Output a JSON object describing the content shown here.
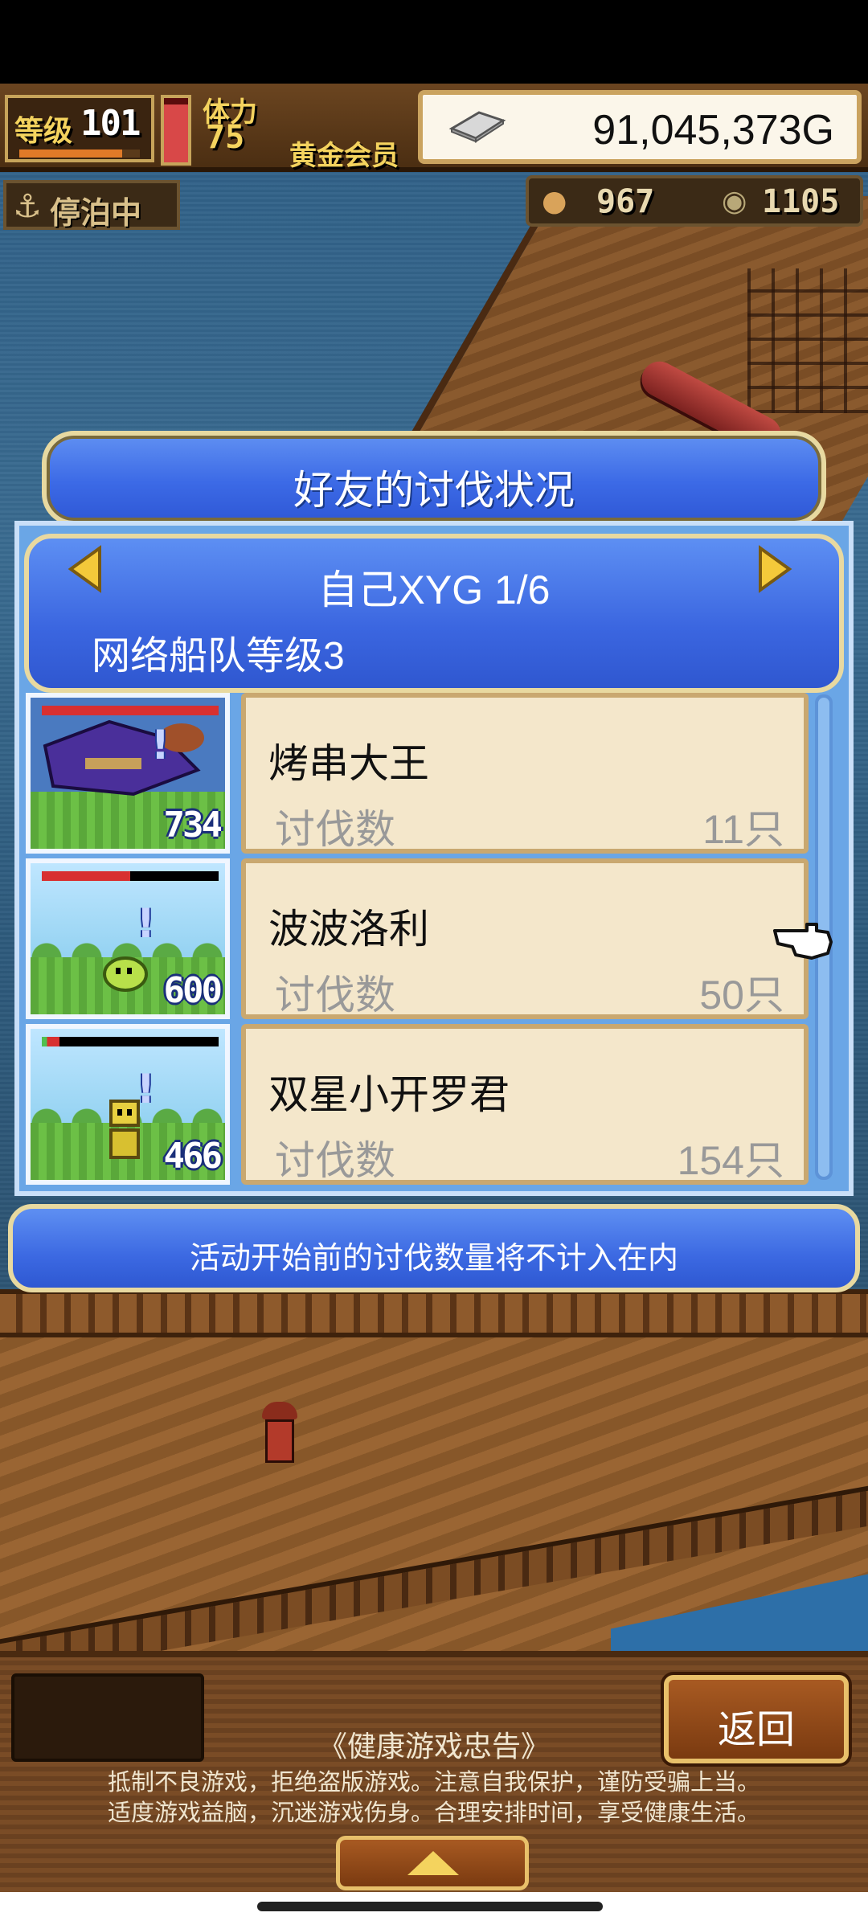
{
  "hud": {
    "level_label": "等级",
    "level": "101",
    "level_progress": 0.85,
    "stamina_label": "体力",
    "stamina": "75",
    "stamina_fill": 0.9,
    "membership": "黄金会员",
    "gold": "91,045,373G",
    "status": "停泊中",
    "resource_1": "967",
    "resource_2": "1105"
  },
  "dialog": {
    "title": "好友的讨伐状况",
    "friend": "自己XYG 1/6",
    "fleet_level": "网络船队等级3",
    "kill_label": "讨伐数",
    "monsters": [
      {
        "name": "烤串大王",
        "power": "734",
        "kills": "11只",
        "hp": 1.0,
        "sprite": "wizard-boss"
      },
      {
        "name": "波波洛利",
        "power": "600",
        "kills": "50只",
        "hp": 0.5,
        "sprite": "green-blob"
      },
      {
        "name": "双星小开罗君",
        "power": "466",
        "kills": "154只",
        "hp": 0.1,
        "sprite": "yellow-robot"
      }
    ],
    "notice": "活动开始前的讨伐数量将不计入在内"
  },
  "bottom": {
    "back_label": "返回",
    "health_title": "《健康游戏忠告》",
    "health_line_1": "抵制不良游戏，拒绝盗版游戏。注意自我保护，谨防受骗上当。",
    "health_line_2": "适度游戏益脑，沉迷游戏伤身。合理安排时间，享受健康生活。"
  },
  "colors": {
    "accent_blue": "#3c6ae6",
    "panel_cream": "#f4e7cb",
    "gold_border": "#e8d9a0"
  }
}
